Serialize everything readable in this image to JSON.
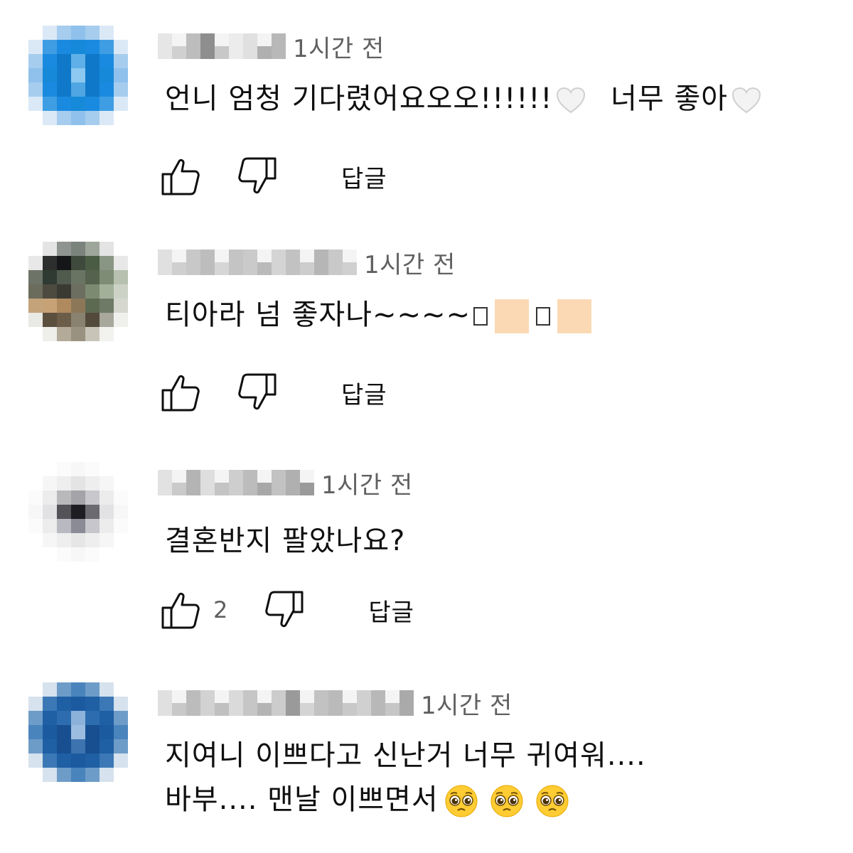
{
  "comments": [
    {
      "time": "1시간 전",
      "lines": [
        "언니 엄청 기다렸어요오오!!!!!!",
        "너무 좋아"
      ],
      "avatar_icon": "blurred-avatar-icon",
      "like_count": "",
      "reply_label": "답글"
    },
    {
      "time": "1시간 전",
      "lines": [
        "티아라 넘 좋자나~~~~"
      ],
      "avatar_icon": "blurred-avatar-icon",
      "like_count": "",
      "reply_label": "답글"
    },
    {
      "time": "1시간 전",
      "lines": [
        "결혼반지 팔았나요?"
      ],
      "avatar_icon": "blurred-avatar-icon",
      "like_count": "2",
      "reply_label": "답글"
    },
    {
      "time": "1시간 전",
      "lines": [
        "지여니 이쁘다고 신난거 너무 귀여워....",
        "바부.... 맨날 이쁘면서"
      ],
      "avatar_icon": "blurred-avatar-icon",
      "like_count": "",
      "reply_label": ""
    }
  ],
  "icons": {
    "like": "thumbs-up-icon",
    "dislike": "thumbs-down-icon",
    "heart": "white-heart-emoji-icon",
    "pleading": "pleading-face-emoji-icon",
    "missing_glyph": "missing-glyph-icon",
    "skin_tone": "skin-tone-modifier-icon"
  },
  "colors": {
    "text": "#0f0f0f",
    "secondary_text": "#606060",
    "background": "#ffffff"
  }
}
